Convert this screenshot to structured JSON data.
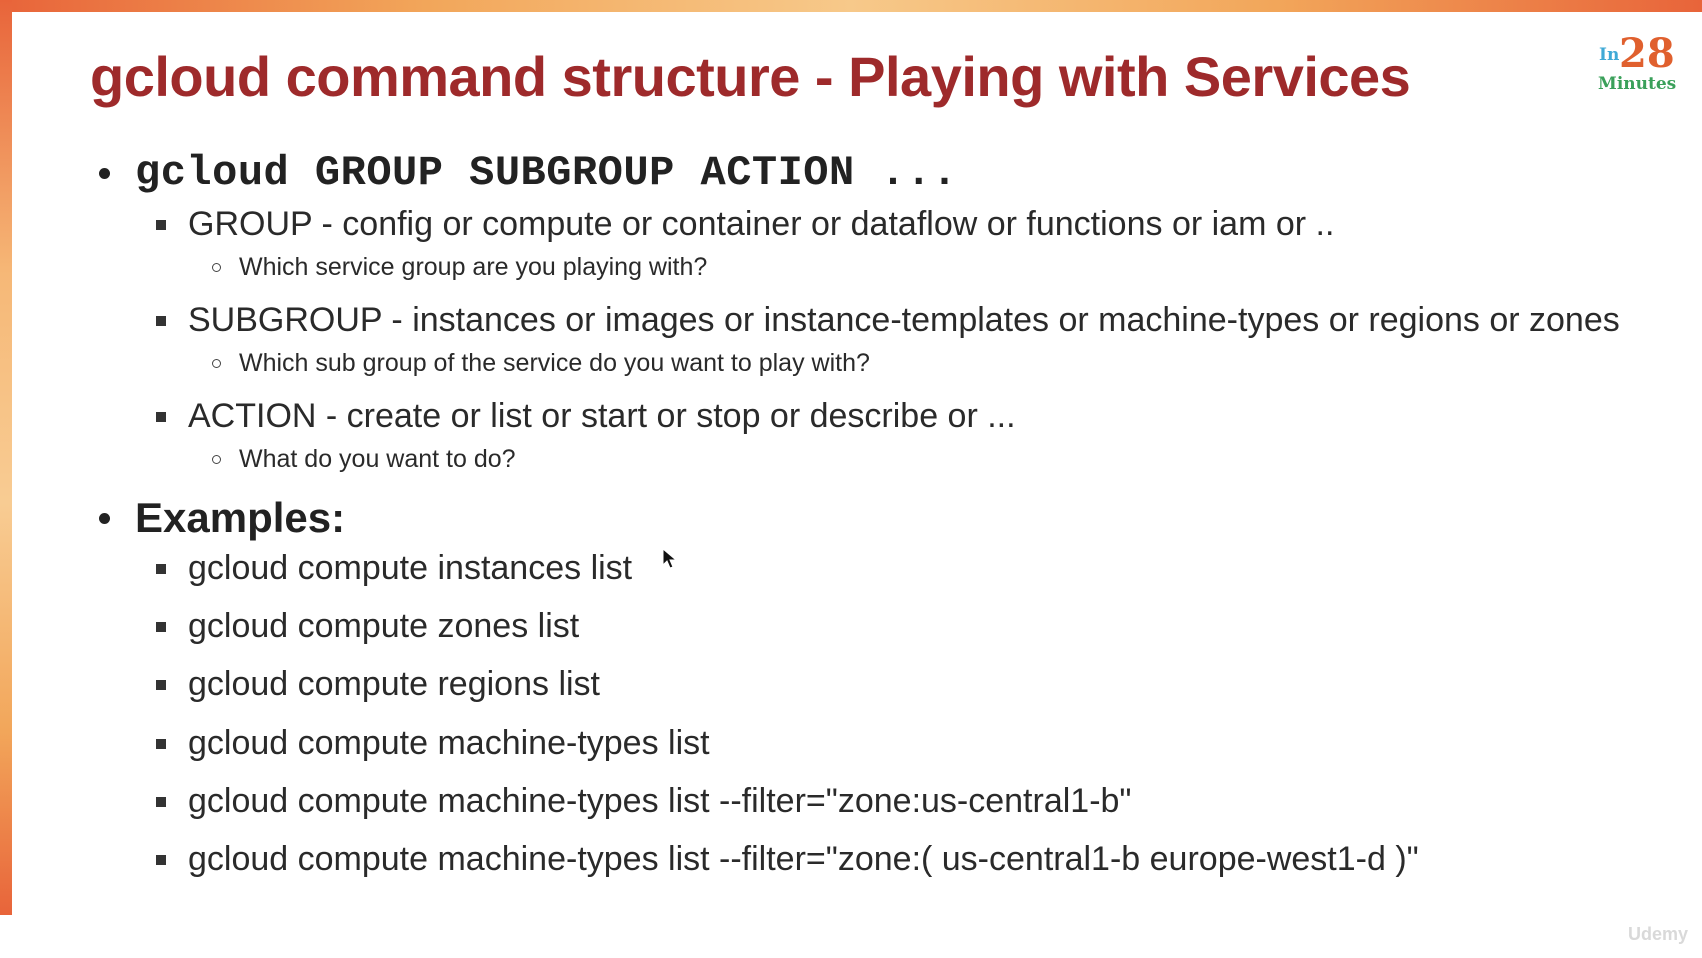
{
  "slide": {
    "title": "gcloud command structure - Playing with Services",
    "logo": {
      "prefix": "In",
      "number": "28",
      "suffix": "Minutes"
    },
    "watermark": "Udemy"
  },
  "structure": {
    "command": "gcloud GROUP SUBGROUP ACTION ...",
    "items": [
      {
        "label": "GROUP - config or compute or container or dataflow or functions or iam or ..",
        "sub": "Which service group are you playing with?"
      },
      {
        "label": "SUBGROUP - instances or images or instance-templates or machine-types or regions or zones",
        "sub": "Which sub group of the service do you want to play with?"
      },
      {
        "label": "ACTION - create or list or start or stop or describe or ...",
        "sub": "What do you want to do?"
      }
    ]
  },
  "examples": {
    "heading": "Examples:",
    "items": [
      "gcloud compute instances list",
      "gcloud compute zones list",
      "gcloud compute regions list",
      "gcloud compute machine-types list",
      "gcloud compute machine-types list --filter=\"zone:us-central1-b\"",
      "gcloud compute machine-types list --filter=\"zone:( us-central1-b europe-west1-d )\""
    ]
  },
  "colors": {
    "title": "#9e2a2b",
    "accent": "#e8643a"
  }
}
